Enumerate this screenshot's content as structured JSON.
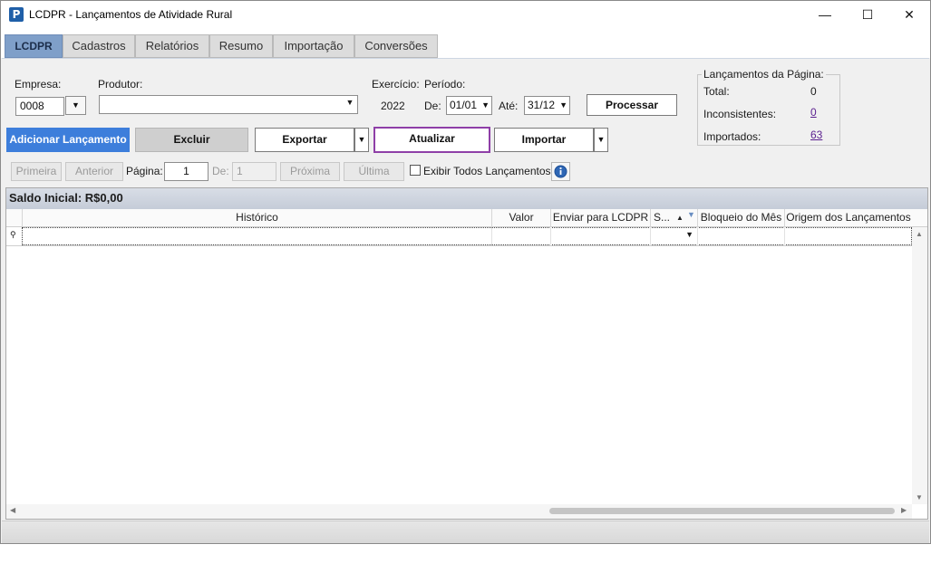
{
  "window": {
    "title": "LCDPR - Lançamentos de Atividade Rural",
    "app_icon_glyph": "P",
    "minimize": "—",
    "maximize": "☐",
    "close": "✕"
  },
  "tabs": [
    {
      "label": "LCDPR",
      "active": true
    },
    {
      "label": "Cadastros",
      "active": false
    },
    {
      "label": "Relatórios",
      "active": false
    },
    {
      "label": "Resumo",
      "active": false
    },
    {
      "label": "Importação",
      "active": false
    },
    {
      "label": "Conversões",
      "active": false
    }
  ],
  "filters": {
    "empresa_label": "Empresa:",
    "empresa_value": "0008",
    "produtor_label": "Produtor:",
    "produtor_value": "",
    "exercicio_label": "Exercício:",
    "exercicio_value": "2022",
    "periodo_label": "Período:",
    "de_label": "De:",
    "de_value": "01/01",
    "ate_label": "Até:",
    "ate_value": "31/12",
    "processar_label": "Processar"
  },
  "summary": {
    "title": "Lançamentos da Página:",
    "total_label": "Total:",
    "total_value": "0",
    "inconsistentes_label": "Inconsistentes:",
    "inconsistentes_value": "0",
    "importados_label": "Importados:",
    "importados_value": "63"
  },
  "actions": {
    "adicionar": "Adicionar Lançamento",
    "excluir": "Excluir",
    "exportar": "Exportar",
    "atualizar": "Atualizar",
    "importar": "Importar"
  },
  "pagination": {
    "primeira": "Primeira",
    "anterior": "Anterior",
    "pagina_label": "Página:",
    "pagina_value": "1",
    "de_label": "De:",
    "de_value": "1",
    "proxima": "Próxima",
    "ultima": "Última",
    "exibir_todos": "Exibir Todos Lançamentos",
    "info_icon": "info-icon"
  },
  "grid": {
    "saldo_inicial": "Saldo Inicial: R$0,00",
    "columns": [
      "Histórico",
      "Valor",
      "Enviar para LCDPR",
      "S...",
      "Bloqueio do Mês",
      "Origem dos Lançamentos"
    ]
  },
  "colors": {
    "accent_blue": "#3d7edb",
    "active_tab": "#7f9fc9",
    "atualizar_border": "#8e3fa7",
    "link": "#5a1f8f"
  }
}
